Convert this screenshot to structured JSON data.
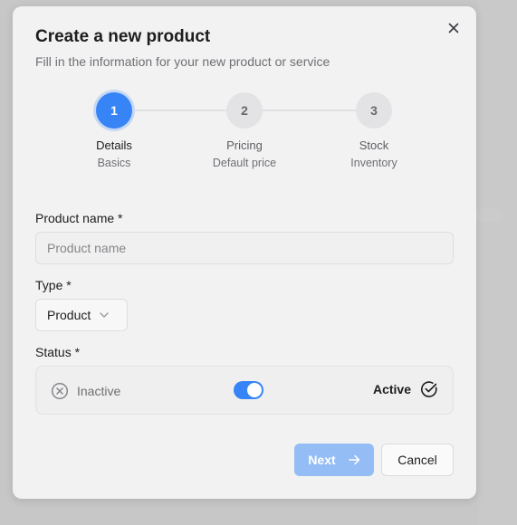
{
  "dialog": {
    "title": "Create a new product",
    "subtitle": "Fill in the information for your new product or service"
  },
  "steps": [
    {
      "number": "1",
      "label": "Details",
      "sublabel": "Basics",
      "active": true
    },
    {
      "number": "2",
      "label": "Pricing",
      "sublabel": "Default price",
      "active": false
    },
    {
      "number": "3",
      "label": "Stock",
      "sublabel": "Inventory",
      "active": false
    }
  ],
  "form": {
    "product_name_label": "Product name *",
    "product_name_placeholder": "Product name",
    "product_name_value": "",
    "type_label": "Type *",
    "type_value": "Product",
    "status_label": "Status *",
    "status_inactive_label": "Inactive",
    "status_active_label": "Active",
    "status_toggle_on": true
  },
  "buttons": {
    "next_label": "Next",
    "cancel_label": "Cancel"
  },
  "icons": {
    "close": "close-icon",
    "chevron": "chevron-down-icon",
    "inactive": "x-circle-icon",
    "active": "check-circle-icon",
    "next_arrow": "arrow-right-icon"
  },
  "colors": {
    "accent": "#3784f6",
    "accent_disabled": "#94bdf6",
    "modal_bg": "#f2f2f2",
    "backdrop": "#c7c7c7"
  }
}
